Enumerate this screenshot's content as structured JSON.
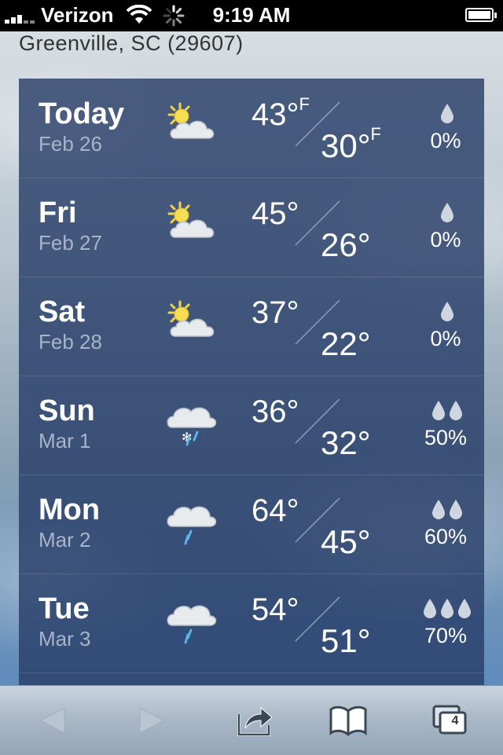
{
  "status_bar": {
    "carrier": "Verizon",
    "time": "9:19 AM"
  },
  "location": "Greenville, SC (29607)",
  "forecast": [
    {
      "day": "Today",
      "date": "Feb 26",
      "icon": "partly-cloudy-icon",
      "high": "43°",
      "high_unit": "F",
      "low": "30°",
      "low_unit": "F",
      "drops": 1,
      "precip": "0%"
    },
    {
      "day": "Fri",
      "date": "Feb 27",
      "icon": "partly-cloudy-icon",
      "high": "45°",
      "low": "26°",
      "drops": 1,
      "precip": "0%"
    },
    {
      "day": "Sat",
      "date": "Feb 28",
      "icon": "partly-cloudy-icon",
      "high": "37°",
      "low": "22°",
      "drops": 1,
      "precip": "0%"
    },
    {
      "day": "Sun",
      "date": "Mar 1",
      "icon": "snow-rain-icon",
      "high": "36°",
      "low": "32°",
      "drops": 2,
      "precip": "50%"
    },
    {
      "day": "Mon",
      "date": "Mar 2",
      "icon": "rain-cloud-icon",
      "high": "64°",
      "low": "45°",
      "drops": 2,
      "precip": "60%"
    },
    {
      "day": "Tue",
      "date": "Mar 3",
      "icon": "rain-cloud-icon",
      "high": "54°",
      "low": "51°",
      "drops": 3,
      "precip": "70%"
    }
  ],
  "toolbar": {
    "tab_count": "4"
  }
}
